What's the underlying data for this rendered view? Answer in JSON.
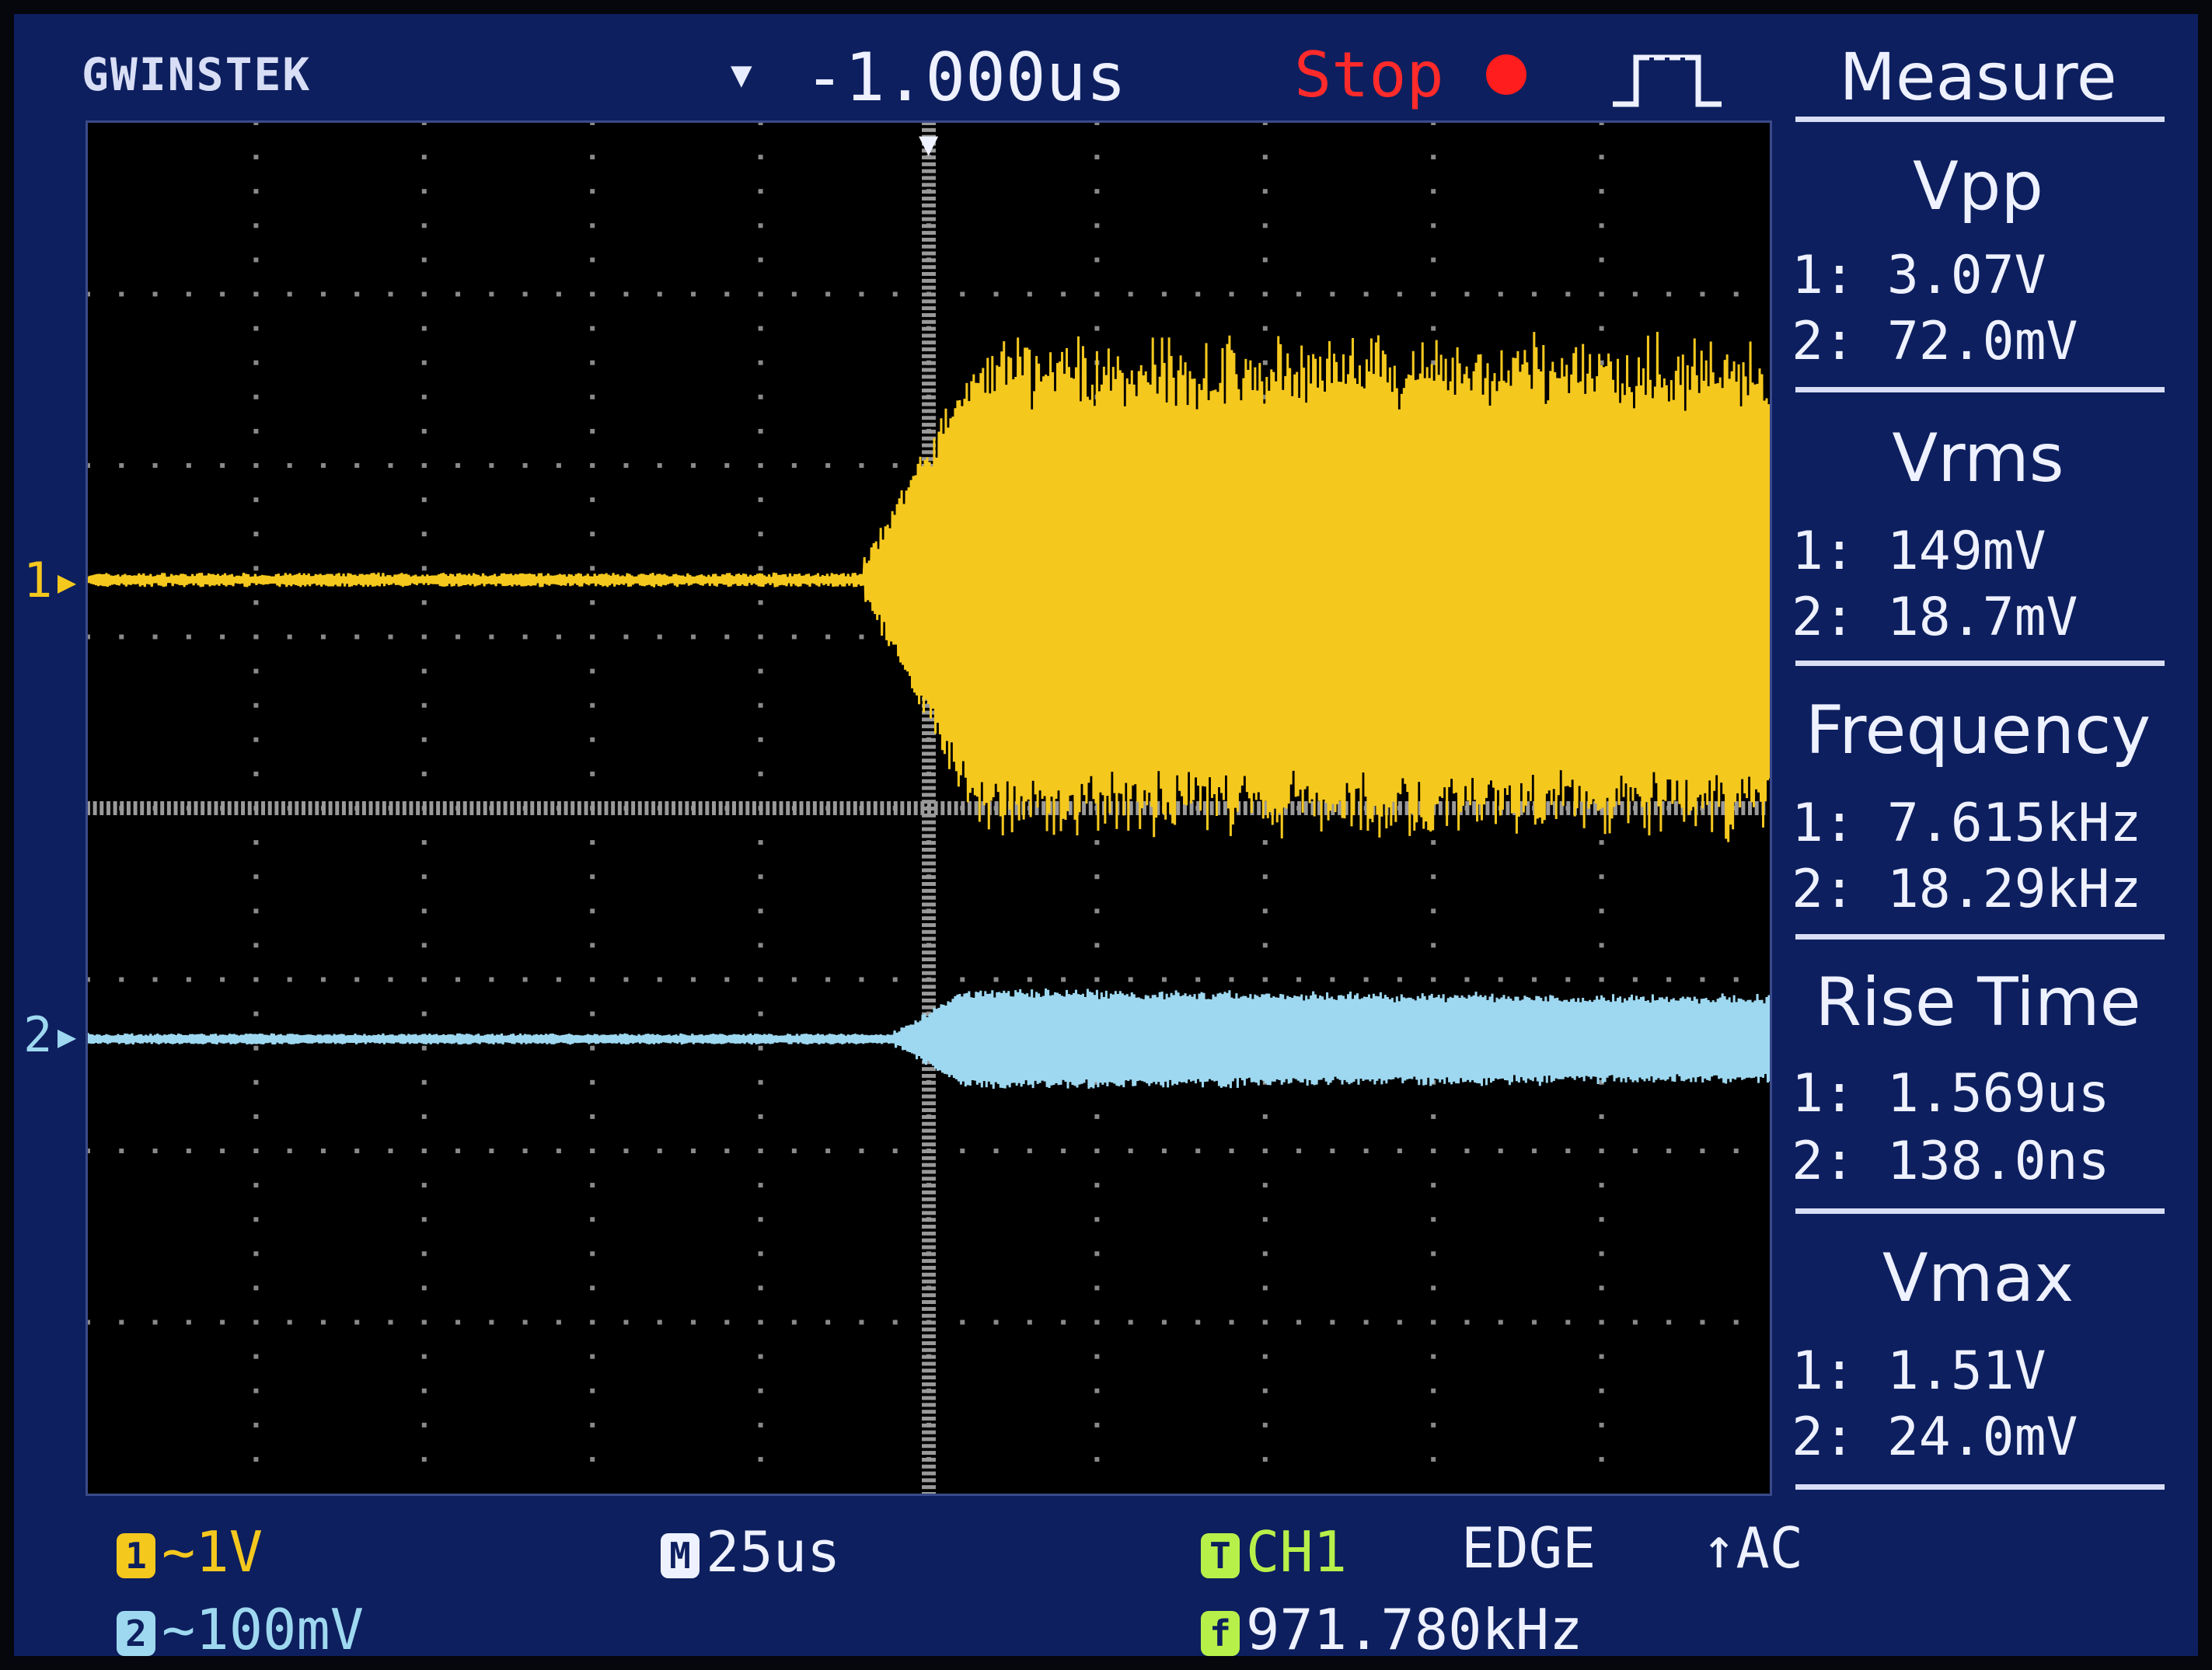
{
  "brand": "GWINSTEK",
  "header": {
    "time_offset": "-1.000us",
    "run_state": "Stop",
    "trigger_marker": "▼"
  },
  "colors": {
    "ch1": "#f5c81e",
    "ch2": "#9ed8f0",
    "background": "#0d1f5e",
    "stop": "#ff2a2a",
    "trigger_src": "#b8f04a"
  },
  "channels": {
    "ch1_label": "1",
    "ch2_label": "2"
  },
  "measure": {
    "title": "Measure",
    "items": [
      {
        "name": "Vpp",
        "ch1": "1: 3.07V",
        "ch2": "2: 72.0mV"
      },
      {
        "name": "Vrms",
        "ch1": "1: 149mV",
        "ch2": "2: 18.7mV"
      },
      {
        "name": "Frequency",
        "ch1": "1: 7.615kHz",
        "ch2": "2: 18.29kHz"
      },
      {
        "name": "Rise Time",
        "ch1": "1: 1.569us",
        "ch2": "2: 138.0ns"
      },
      {
        "name": "Vmax",
        "ch1": "1: 1.51V",
        "ch2": "2: 24.0mV"
      }
    ]
  },
  "bottom": {
    "ch1_badge": "1",
    "ch1_scale": "~1V",
    "ch2_badge": "2",
    "ch2_scale": "~100mV",
    "timebase_badge": "M",
    "timebase": "25us",
    "trig_badge": "T",
    "trig_source": "CH1",
    "trig_mode": "EDGE",
    "trig_coupling": "↑AC",
    "freq_badge": "f",
    "trig_freq": "971.780kHz"
  }
}
